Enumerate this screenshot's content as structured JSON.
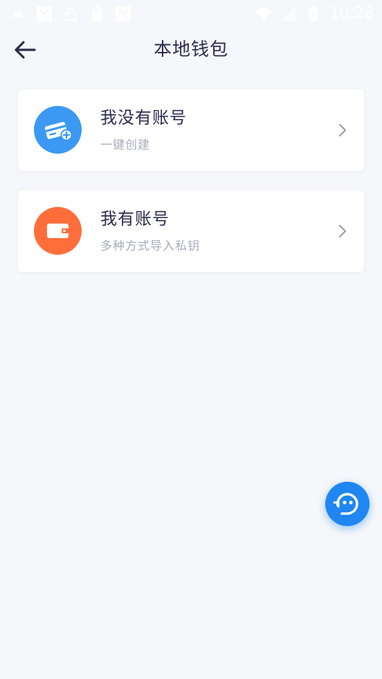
{
  "status_bar": {
    "time": "10:28",
    "icons": [
      "notification-icon",
      "image-icon",
      "android-icon",
      "bag-icon",
      "image-icon",
      "wifi-icon",
      "signal-icon",
      "battery-icon"
    ]
  },
  "header": {
    "title": "本地钱包",
    "back_icon": "arrow-left-icon"
  },
  "options": [
    {
      "title": "我没有账号",
      "subtitle": "一键创建",
      "icon": "add-card-icon",
      "icon_color": "#3b99f4"
    },
    {
      "title": "我有账号",
      "subtitle": "多种方式导入私钥",
      "icon": "wallet-icon",
      "icon_color": "#ff6e3a"
    }
  ],
  "fab": {
    "icon": "support-chat-icon",
    "color": "#1f86f2"
  },
  "colors": {
    "background": "#f6f7fa",
    "title_text": "#2b2c4e",
    "subtitle_text": "#a9abbc"
  }
}
